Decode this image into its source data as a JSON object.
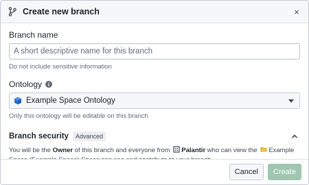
{
  "dialog": {
    "title": "Create new branch",
    "close_label": "×"
  },
  "branch_name": {
    "label": "Branch name",
    "placeholder": "A short descriptive name for this branch",
    "value": "",
    "helper": "Do not include sensitive information"
  },
  "ontology": {
    "label": "Ontology",
    "info_icon": "i",
    "selected": "Example Space Ontology",
    "helper": "Only this ontology will be editable on this branch"
  },
  "security": {
    "label": "Branch security",
    "badge": "Advanced",
    "desc_part1": "You will be the ",
    "owner": "Owner",
    "desc_part2": " of this branch and everyone from ",
    "org": "Palantir",
    "desc_part3": " who can view the ",
    "space": "Example Space (Example Space)",
    "desc_part4": " Space can see and contribute to your branch."
  },
  "footer": {
    "cancel_label": "Cancel",
    "create_label": "Create"
  },
  "colors": {
    "primary_disabled": "#9fc6b0",
    "ontology_cube": "#2d72d2",
    "folder": "#d9a93a"
  },
  "icons": {
    "title": "git-branch-icon",
    "close": "close-icon",
    "ontology": "cube-icon",
    "collapse": "chevron-up-icon",
    "org": "building-icon",
    "space": "folder-icon"
  }
}
